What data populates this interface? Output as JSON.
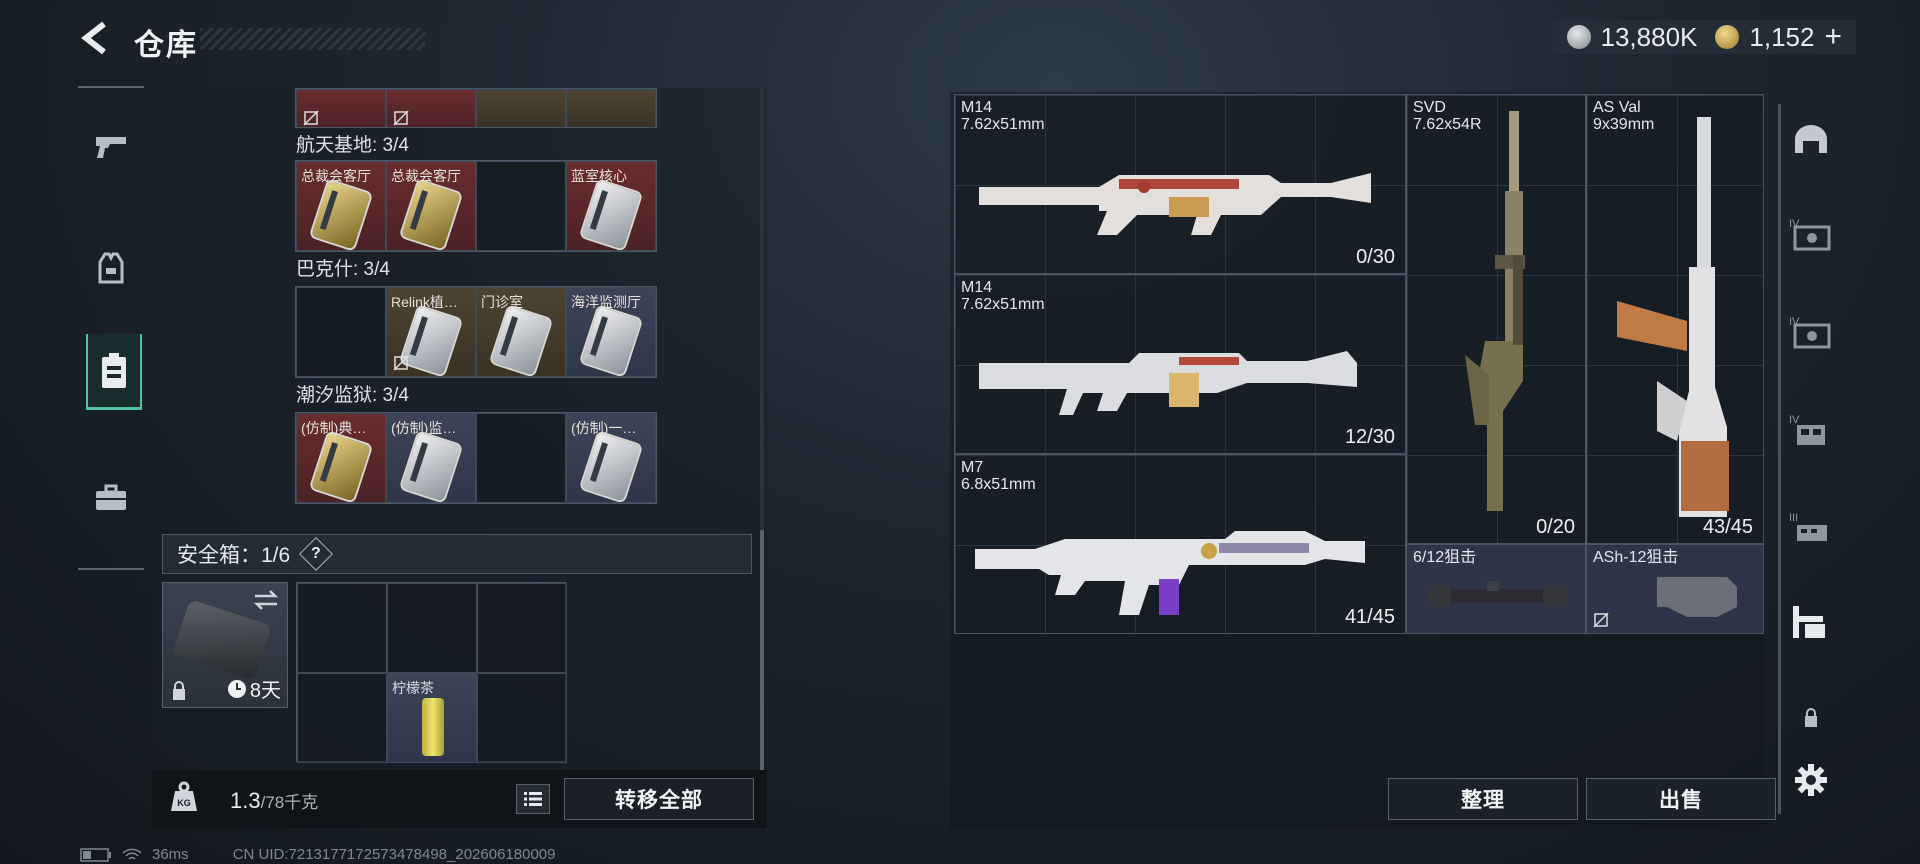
{
  "header": {
    "title": "仓库"
  },
  "currency": {
    "silver": "13,880K",
    "gold": "1,152",
    "plus": "+"
  },
  "left_sections": [
    {
      "title": "航天基地: 3/4",
      "items": [
        {
          "label": "总裁会客厅",
          "color": "red",
          "card": "gold"
        },
        {
          "label": "总裁会客厅",
          "color": "red",
          "card": "gold"
        },
        {
          "label": "",
          "color": "empty",
          "card": ""
        },
        {
          "label": "蓝室核心",
          "color": "red",
          "card": "silver"
        }
      ]
    },
    {
      "title": "巴克什: 3/4",
      "items": [
        {
          "label": "",
          "color": "empty",
          "card": ""
        },
        {
          "label": "Relink植…",
          "color": "gold",
          "card": "silver",
          "nolink": true
        },
        {
          "label": "门诊室",
          "color": "gold",
          "card": "silver"
        },
        {
          "label": "海洋监测厅",
          "color": "blue",
          "card": "silver"
        }
      ]
    },
    {
      "title": "潮汐监狱: 3/4",
      "items": [
        {
          "label": "(仿制)典…",
          "color": "red",
          "card": "gold"
        },
        {
          "label": "(仿制)监…",
          "color": "blue",
          "card": "silver"
        },
        {
          "label": "",
          "color": "empty",
          "card": ""
        },
        {
          "label": "(仿制)一…",
          "color": "blue",
          "card": "silver"
        }
      ]
    }
  ],
  "safe_box": {
    "label": "安全箱：1/6",
    "help": "?",
    "duration": "8天",
    "item_label": "柠檬茶"
  },
  "footer": {
    "weight": "1.3",
    "capacity": "/78千克",
    "transfer_all": "转移全部",
    "sort": "整理",
    "sell": "出售"
  },
  "status": {
    "ping": "36ms",
    "uid": "CN UID:7213177172573478498_202606180009"
  },
  "weapons": [
    {
      "name": "M14",
      "caliber": "7.62x51mm",
      "ammo": "0/30"
    },
    {
      "name": "M14",
      "caliber": "7.62x51mm",
      "ammo": "12/30"
    },
    {
      "name": "M7",
      "caliber": "6.8x51mm",
      "ammo": "41/45"
    },
    {
      "name": "SVD",
      "caliber": "7.62x54R",
      "ammo": "0/20"
    },
    {
      "name": "AS Val",
      "caliber": "9x39mm",
      "ammo": "43/45"
    },
    {
      "name": "6/12狙击",
      "caliber": "",
      "ammo": ""
    },
    {
      "name": "ASh-12狙击",
      "caliber": "",
      "ammo": ""
    }
  ],
  "right_tabs": [
    "helmet",
    "armor-iv",
    "armor-iv",
    "rig-iv",
    "rig-iii",
    "backpack",
    "lock",
    "settings"
  ],
  "colors": {
    "accent": "#4fc3a1",
    "red_slot": "#6a2c2f",
    "gold_slot": "#4d4332",
    "blue_slot": "#3e4457"
  }
}
